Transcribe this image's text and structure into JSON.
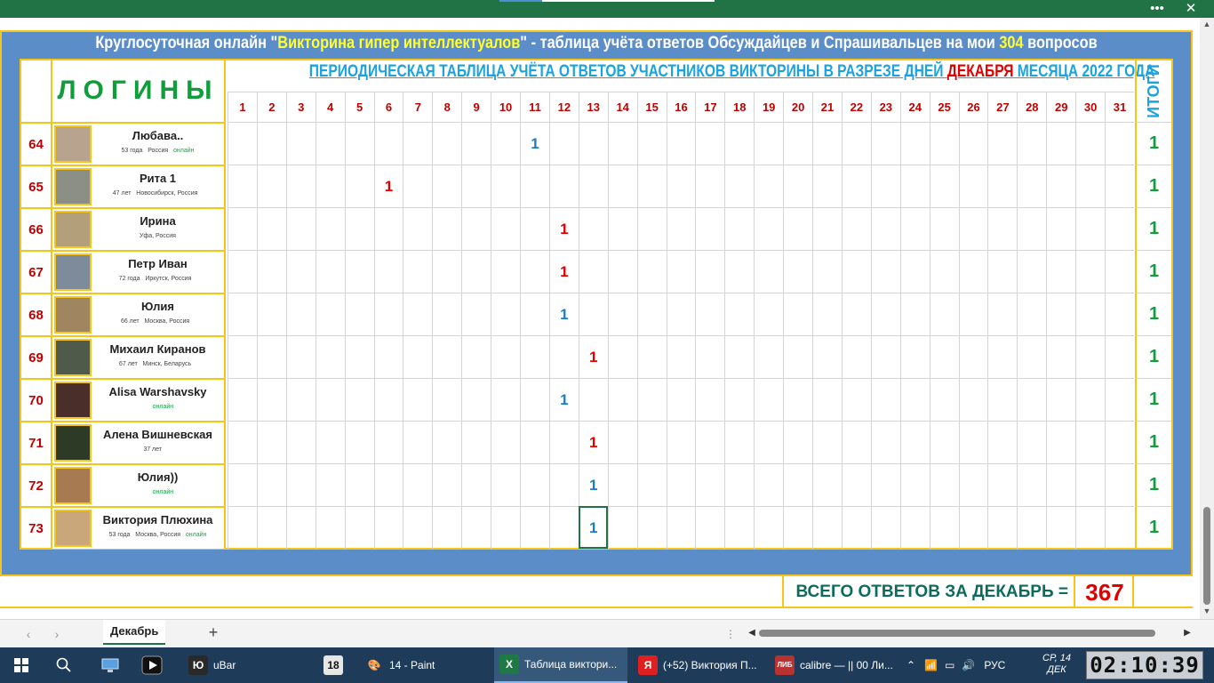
{
  "window": {
    "menu_icon": "more-options-icon",
    "close_icon": "close-icon",
    "more_glyph": "•••",
    "close_glyph": "✕"
  },
  "sheet": {
    "headline_part1": "Круглосуточная онлайн \"",
    "headline_highlight": "Викторина гипер интеллектуалов",
    "headline_part2": "\" - таблица учёта ответов Обсуждайцев и Спрашивальцев на мои ",
    "headline_count": "304",
    "headline_part3": " вопросов",
    "logins_header": "ЛОГИНЫ",
    "period_header_part1": "ПЕРИОДИЧЕСКАЯ ТАБЛИЦА УЧЁТА ОТВЕТОВ УЧАСТНИКОВ ВИКТОРИНЫ В РАЗРЕЗЕ  ДНЕЙ ",
    "period_header_month": "ДЕКАБРЯ",
    "period_header_part2": "  МЕСЯЦА  2022  ГОДА",
    "itogi_header": "ИТОГИ",
    "days": [
      "1",
      "2",
      "3",
      "4",
      "5",
      "6",
      "7",
      "8",
      "9",
      "10",
      "11",
      "12",
      "13",
      "14",
      "15",
      "16",
      "17",
      "18",
      "19",
      "20",
      "21",
      "22",
      "23",
      "24",
      "25",
      "26",
      "27",
      "28",
      "29",
      "30",
      "31"
    ],
    "rows": [
      {
        "num": "64",
        "name": "Любава..",
        "age": "53 года",
        "city": "Россия",
        "status": "онлайн",
        "day": 11,
        "value": "1",
        "color": "#1a7fc4",
        "total": "1",
        "avatar_color": "#b8a38e"
      },
      {
        "num": "65",
        "name": "Рита 1",
        "age": "47 лет",
        "city": "Новосибирск, Россия",
        "status": "",
        "day": 6,
        "value": "1",
        "color": "#e00000",
        "total": "1",
        "avatar_color": "#8b8f86"
      },
      {
        "num": "66",
        "name": "Ирина",
        "age": "",
        "city": "Уфа, Россия",
        "status": "",
        "day": 12,
        "value": "1",
        "color": "#e00000",
        "total": "1",
        "avatar_color": "#b3a07a"
      },
      {
        "num": "67",
        "name": "Петр Иван",
        "age": "72 года",
        "city": "Иркутск, Россия",
        "status": "",
        "day": 12,
        "value": "1",
        "color": "#e00000",
        "total": "1",
        "avatar_color": "#7d8b9a"
      },
      {
        "num": "68",
        "name": "Юлия",
        "age": "66 лет",
        "city": "Москва, Россия",
        "status": "",
        "day": 12,
        "value": "1",
        "color": "#1a7fc4",
        "total": "1",
        "avatar_color": "#9f8660"
      },
      {
        "num": "69",
        "name": "Михаил Киранов",
        "age": "67 лет",
        "city": "Минск, Беларусь",
        "status": "",
        "day": 13,
        "value": "1",
        "color": "#e00000",
        "total": "1",
        "avatar_color": "#4f5a4a"
      },
      {
        "num": "70",
        "name": "Alisa Warshavsky",
        "age": "",
        "city": "",
        "status": "онлайн",
        "day": 12,
        "value": "1",
        "color": "#1a7fc4",
        "total": "1",
        "avatar_color": "#4a2e2a"
      },
      {
        "num": "71",
        "name": "Алена Вишневская",
        "age": "37 лет",
        "city": "",
        "status": "",
        "day": 13,
        "value": "1",
        "color": "#e00000",
        "total": "1",
        "avatar_color": "#2d3a26"
      },
      {
        "num": "72",
        "name": "Юлия))",
        "age": "",
        "city": "",
        "status": "онлайн",
        "day": 13,
        "value": "1",
        "color": "#1a7fc4",
        "total": "1",
        "avatar_color": "#a77a52"
      },
      {
        "num": "73",
        "name": "Виктория Плюхина",
        "age": "53 года",
        "city": "Москва, Россия",
        "status": "онлайн",
        "day": 13,
        "value": "1",
        "color": "#1a7fc4",
        "total": "1",
        "avatar_color": "#c9a77a"
      }
    ],
    "footer_label": "ВСЕГО ОТВЕТОВ ЗА ДЕКАБРЬ =",
    "footer_value": "367"
  },
  "tabs": {
    "active_tab": "Декабрь",
    "add_glyph": "+",
    "prev_glyph": "‹",
    "next_glyph": "›",
    "dots_glyph": "⋮"
  },
  "taskbar": {
    "items": [
      {
        "label": "uBar",
        "icon": "Ю",
        "icon_bg": "#2a2a2a",
        "icon_name": "ubar-icon"
      },
      {
        "label": "",
        "icon": "18",
        "icon_bg": "#e6e6e6",
        "icon_name": "age-rating-icon"
      },
      {
        "label": "14 - Paint",
        "icon": "🎨",
        "icon_bg": "transparent",
        "icon_name": "paint-icon"
      },
      {
        "label": "Таблица виктори...",
        "icon": "X",
        "icon_bg": "#1d7a44",
        "icon_name": "excel-icon"
      },
      {
        "label": "(+52) Виктория П...",
        "icon": "Я",
        "icon_bg": "#e02020",
        "icon_name": "yandex-browser-icon"
      },
      {
        "label": "calibre — || 00 Ли...",
        "icon": "ЛИБ",
        "icon_bg": "#b93232",
        "icon_name": "calibre-icon"
      }
    ],
    "lang": "РУС",
    "clock_day": "СР, 14",
    "clock_month": "ДЕК",
    "digital_clock": "02:10:39"
  }
}
